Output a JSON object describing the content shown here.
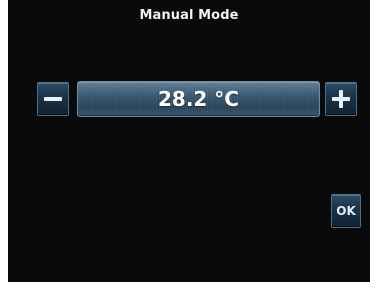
{
  "header": {
    "title": "Manual Mode"
  },
  "temperature": {
    "value": "28.2 °C"
  },
  "controls": {
    "ok_label": "OK",
    "decrease_icon": "minus-icon",
    "increase_icon": "plus-icon"
  },
  "colors": {
    "screen_background": "#0a0a0b",
    "button_fill": "#1b3246",
    "button_border": "#4b6f8b",
    "display_fill": "#3b5870",
    "text": "#ffffff"
  }
}
